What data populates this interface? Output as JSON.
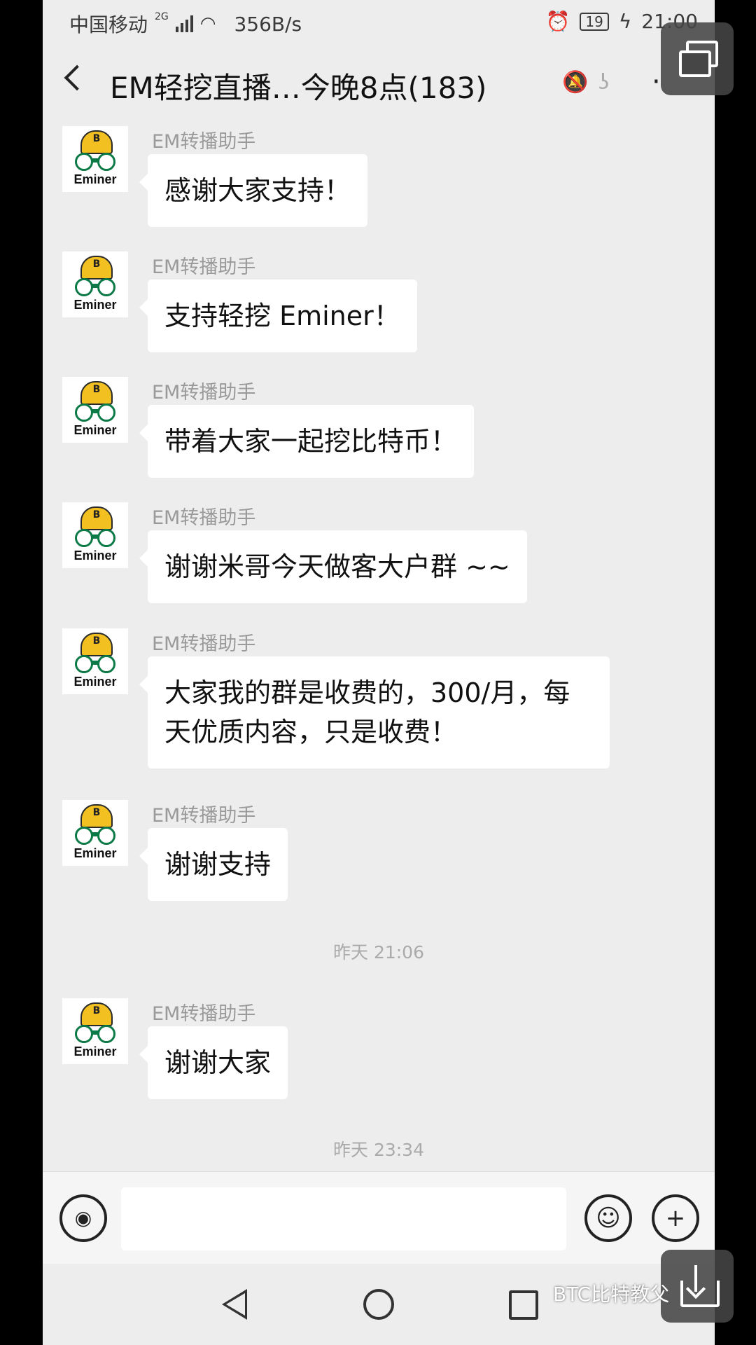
{
  "status_bar": {
    "carrier": "中国移动",
    "net_type": "2G",
    "speed": "356B/s",
    "battery": "19",
    "time": "21:00"
  },
  "header": {
    "title": "EM轻挖直播…今晚8点(183)",
    "back_icon": "chevron-left-icon",
    "mute_icon": "bell-off-icon",
    "earpiece_icon": "ear-icon",
    "more_icon": "more-icon"
  },
  "avatar_brand": "Eminer",
  "messages": [
    {
      "sender": "EM转播助手",
      "text": "感谢大家支持！"
    },
    {
      "sender": "EM转播助手",
      "text": "支持轻挖 Eminer！"
    },
    {
      "sender": "EM转播助手",
      "text": "带着大家一起挖比特币！"
    },
    {
      "sender": "EM转播助手",
      "text": "谢谢米哥今天做客大户群 ~~"
    },
    {
      "sender": "EM转播助手",
      "text": "大家我的群是收费的，300/月，每天优质内容，只是收费！"
    },
    {
      "sender": "EM转播助手",
      "text": "谢谢支持"
    },
    {
      "sender": "EM转播助手",
      "text": "谢谢大家"
    }
  ],
  "timestamps": [
    "昨天 21:06",
    "昨天 23:34"
  ],
  "watermark": "BTC比特教父",
  "colors": {
    "background": "#ededed",
    "bubble": "#ffffff",
    "helmet": "#f2c021",
    "goggles": "#0c7a46"
  }
}
